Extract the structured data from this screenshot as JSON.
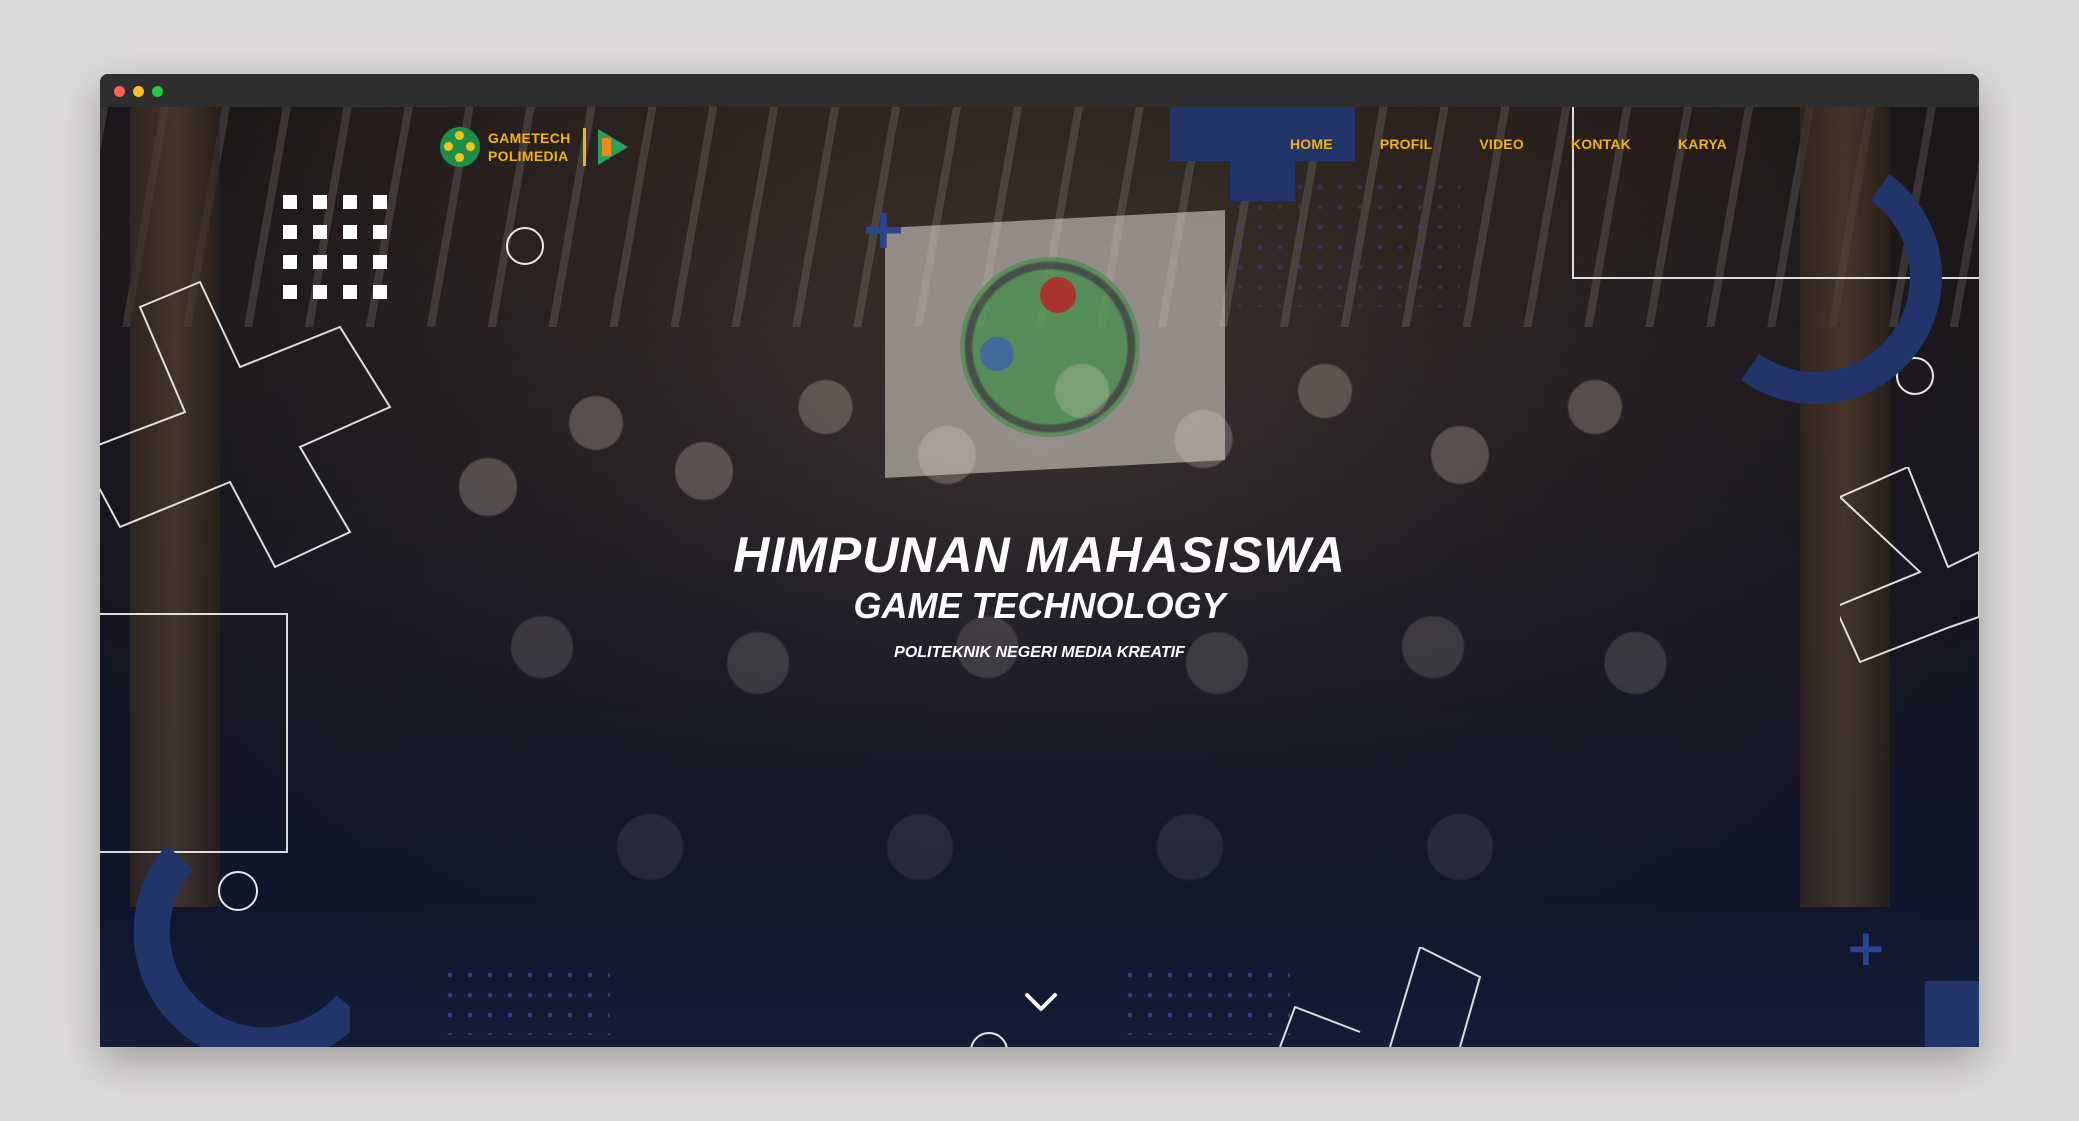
{
  "window": {
    "controls": [
      "close",
      "minimize",
      "maximize"
    ]
  },
  "logo": {
    "line1": "GAMETECH",
    "line2": "POLIMEDIA",
    "brand_color": "#f2b21b",
    "icon_names": [
      "gamepad-logo-icon",
      "play-logo-icon"
    ]
  },
  "nav": {
    "items": [
      {
        "label": "HOME"
      },
      {
        "label": "PROFIL"
      },
      {
        "label": "VIDEO"
      },
      {
        "label": "KONTAK"
      },
      {
        "label": "KARYA"
      }
    ],
    "accent_color": "#22356b"
  },
  "hero": {
    "title_line1": "HIMPUNAN MAHASISWA",
    "title_line2": "GAME TECHNOLOGY",
    "subtitle": "POLITEKNIK NEGERI MEDIA KREATIF",
    "scroll_icon": "chevron-down-icon"
  }
}
